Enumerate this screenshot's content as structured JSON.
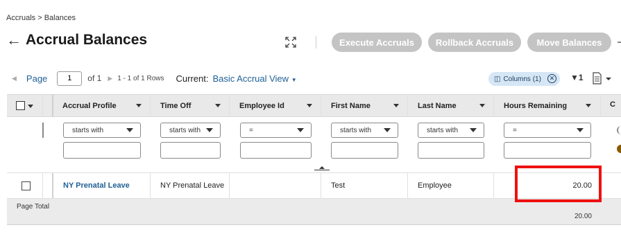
{
  "breadcrumb": "Accruals > Balances",
  "page_title": "Accrual Balances",
  "toolbar": {
    "execute_label": "Execute Accruals",
    "rollback_label": "Rollback Accruals",
    "move_label": "Move Balances"
  },
  "pager": {
    "page_label": "Page",
    "page_value": "1",
    "of_label": "of 1",
    "rows_label": "1 - 1 of 1 Rows",
    "current_label": "Current:",
    "view_name": "Basic Accrual View"
  },
  "columns_chip": "Columns (1)",
  "filter_count": "1",
  "columns": [
    {
      "label": "Accrual Profile",
      "filter_op": "starts with"
    },
    {
      "label": "Time Off",
      "filter_op": "starts with"
    },
    {
      "label": "Employee Id",
      "filter_op": "="
    },
    {
      "label": "First Name",
      "filter_op": "starts with"
    },
    {
      "label": "Last Name",
      "filter_op": "starts with"
    },
    {
      "label": "Hours Remaining",
      "filter_op": "="
    }
  ],
  "rows": [
    {
      "accrual_profile": "NY Prenatal Leave",
      "time_off": "NY Prenatal Leave",
      "employee_id": "",
      "first_name": "Test",
      "last_name": "Employee",
      "hours_remaining": "20.00"
    }
  ],
  "totals": {
    "label": "Page Total",
    "hours_remaining": "20.00"
  },
  "colors": {
    "link": "#1f5f96",
    "button_disabled": "#c4c4c4",
    "highlight": "#e11111",
    "chip_bg": "#d5e6f5"
  }
}
